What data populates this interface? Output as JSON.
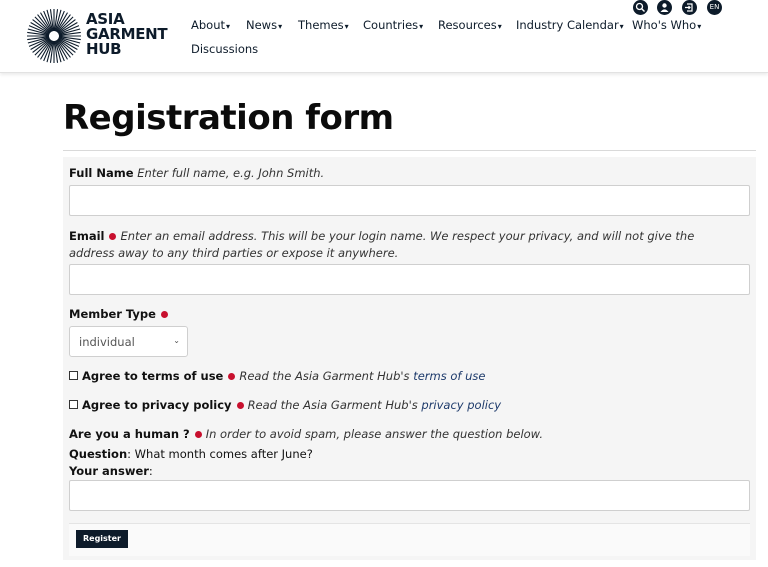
{
  "brand": {
    "logo_text": "ASIA\nGARMENT\nHUB"
  },
  "nav": {
    "items": [
      {
        "label": "About",
        "name": "about"
      },
      {
        "label": "News",
        "name": "news"
      },
      {
        "label": "Themes",
        "name": "themes"
      },
      {
        "label": "Countries",
        "name": "countries"
      },
      {
        "label": "Resources",
        "name": "resources"
      },
      {
        "label": "Industry Calendar",
        "name": "industry-calendar"
      },
      {
        "label": "Who's Who",
        "name": "whos-who"
      }
    ],
    "discussions": "Discussions",
    "caret": "▾",
    "lang": "EN"
  },
  "page": {
    "title": "Registration form"
  },
  "form": {
    "full_name": {
      "label": "Full Name",
      "description": "Enter full name, e.g. John Smith.",
      "value": ""
    },
    "email": {
      "label": "Email",
      "description_line1": "Enter an email address. This will be your login name. We respect your privacy, and will not give the",
      "description_line2": "address away to any third parties or expose it anywhere.",
      "value": ""
    },
    "member_type": {
      "label": "Member Type",
      "selected": "individual",
      "chevron": "⌄"
    },
    "terms": {
      "label": "Agree to terms of use",
      "desc_prefix": "Read the Asia Garment Hub's",
      "link": "terms of use"
    },
    "privacy": {
      "label": "Agree to privacy policy",
      "desc_prefix": "Read the Asia Garment Hub's",
      "link": "privacy policy"
    },
    "human": {
      "label": "Are you a human ?",
      "description": "In order to avoid spam, please answer the question below.",
      "question_label": "Question",
      "question": ": What month comes after June?",
      "answer_label": "Your answer",
      "answer_colon": ":",
      "value": ""
    },
    "register_label": "Register"
  },
  "colors": {
    "navy": "#0d1b2a",
    "required": "#c8102e",
    "form_bg": "#f5f5f5"
  }
}
